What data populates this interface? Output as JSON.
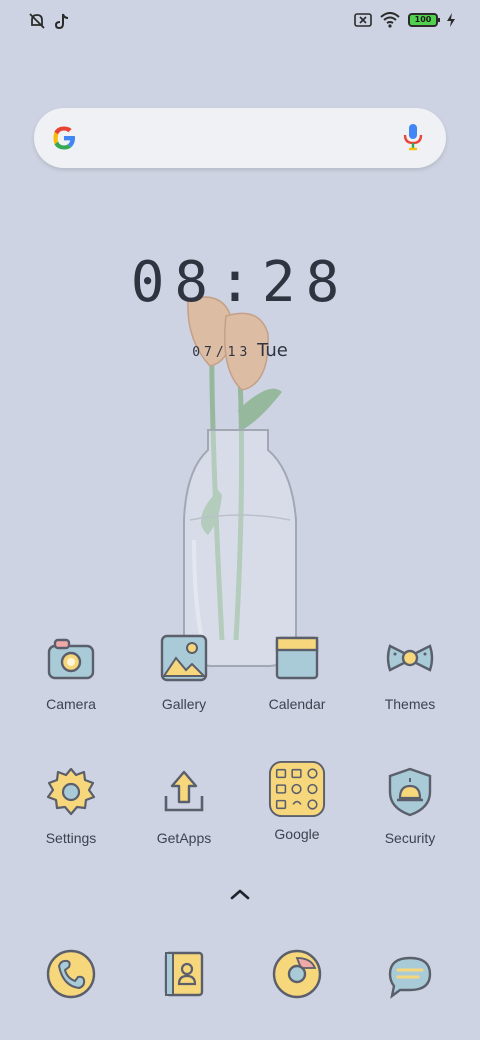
{
  "status_bar": {
    "icons_left": [
      "mute-icon",
      "tiktok-icon"
    ],
    "icons_right": [
      "sim-off-icon",
      "wifi-icon",
      "battery-icon",
      "charging-icon"
    ],
    "battery": "100"
  },
  "search": {
    "logo": "google-g-icon",
    "mic": "mic-icon"
  },
  "clock": {
    "time": "08:28",
    "date": "07/13",
    "weekday": "Tue"
  },
  "apps_row1": [
    {
      "label": "Camera",
      "icon": "camera-icon"
    },
    {
      "label": "Gallery",
      "icon": "gallery-icon"
    },
    {
      "label": "Calendar",
      "icon": "calendar-icon"
    },
    {
      "label": "Themes",
      "icon": "themes-icon"
    }
  ],
  "apps_row2": [
    {
      "label": "Settings",
      "icon": "settings-icon"
    },
    {
      "label": "GetApps",
      "icon": "getapps-icon"
    },
    {
      "label": "Google",
      "icon": "google-folder-icon"
    },
    {
      "label": "Security",
      "icon": "security-icon"
    }
  ],
  "drawer": {
    "icon": "chevron-up-icon"
  },
  "dock": [
    {
      "icon": "phone-icon"
    },
    {
      "icon": "contacts-icon"
    },
    {
      "icon": "chrome-icon"
    },
    {
      "icon": "messages-icon"
    }
  ],
  "colors": {
    "background": "#cdd3e2",
    "icon_yellow": "#f7d77c",
    "icon_blue": "#a9cbd8",
    "outline": "#5b5f6b"
  }
}
